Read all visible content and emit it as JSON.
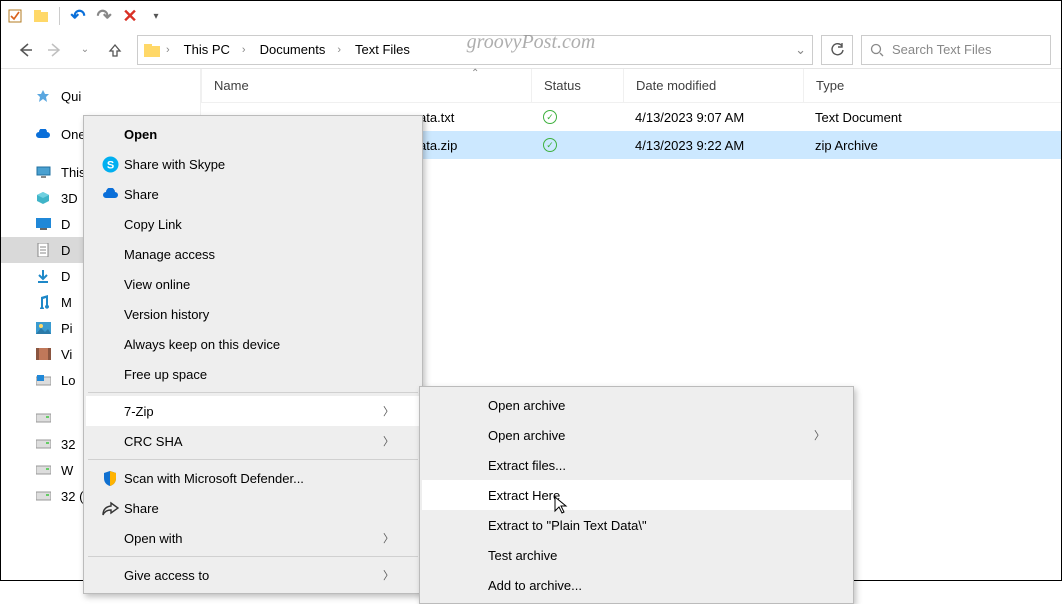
{
  "watermark": "groovyPost.com",
  "titlebar": {
    "undo": "↶",
    "redo": "↷",
    "delete": "✕"
  },
  "breadcrumbs": [
    "This PC",
    "Documents",
    "Text Files"
  ],
  "search_placeholder": "Search Text Files",
  "columns": {
    "name": "Name",
    "status": "Status",
    "date": "Date modified",
    "type": "Type"
  },
  "sidebar": {
    "items": [
      {
        "label": "Qui",
        "icon": "star"
      },
      {
        "label": "One",
        "icon": "cloud"
      },
      {
        "label": "This",
        "icon": "pc"
      },
      {
        "label": "3D",
        "icon": "cube"
      },
      {
        "label": "D",
        "icon": "desktop"
      },
      {
        "label": "D",
        "icon": "document",
        "selected": true
      },
      {
        "label": "D",
        "icon": "download"
      },
      {
        "label": "M",
        "icon": "music"
      },
      {
        "label": "Pi",
        "icon": "picture"
      },
      {
        "label": "Vi",
        "icon": "video"
      },
      {
        "label": "Lo",
        "icon": "disk-win"
      },
      {
        "label": "",
        "icon": "disk"
      },
      {
        "label": "32",
        "icon": "disk"
      },
      {
        "label": "W",
        "icon": "disk"
      },
      {
        "label": "32 (",
        "icon": "disk"
      }
    ]
  },
  "files": [
    {
      "name": "ata.txt",
      "status": "ok",
      "date": "4/13/2023 9:07 AM",
      "type": "Text Document",
      "selected": false
    },
    {
      "name": "ata.zip",
      "status": "ok",
      "date": "4/13/2023 9:22 AM",
      "type": "zip Archive",
      "selected": true
    }
  ],
  "context_menu": [
    {
      "label": "Open",
      "bold": true
    },
    {
      "label": "Share with Skype",
      "icon": "skype"
    },
    {
      "label": "Share",
      "icon": "cloud-share"
    },
    {
      "label": "Copy Link"
    },
    {
      "label": "Manage access"
    },
    {
      "label": "View online"
    },
    {
      "label": "Version history"
    },
    {
      "label": "Always keep on this device"
    },
    {
      "label": "Free up space"
    },
    {
      "sep": true
    },
    {
      "label": "7-Zip",
      "arrow": true,
      "hover": true
    },
    {
      "label": "CRC SHA",
      "arrow": true
    },
    {
      "sep": true
    },
    {
      "label": "Scan with Microsoft Defender...",
      "icon": "shield"
    },
    {
      "label": "Share",
      "icon": "share-arrow"
    },
    {
      "label": "Open with",
      "arrow": true
    },
    {
      "sep": true
    },
    {
      "label": "Give access to",
      "arrow": true
    }
  ],
  "submenu": [
    {
      "label": "Open archive"
    },
    {
      "label": "Open archive",
      "arrow": true
    },
    {
      "label": "Extract files..."
    },
    {
      "label": "Extract Here",
      "hover": true
    },
    {
      "label": "Extract to \"Plain Text Data\\\""
    },
    {
      "label": "Test archive"
    },
    {
      "label": "Add to archive..."
    }
  ]
}
